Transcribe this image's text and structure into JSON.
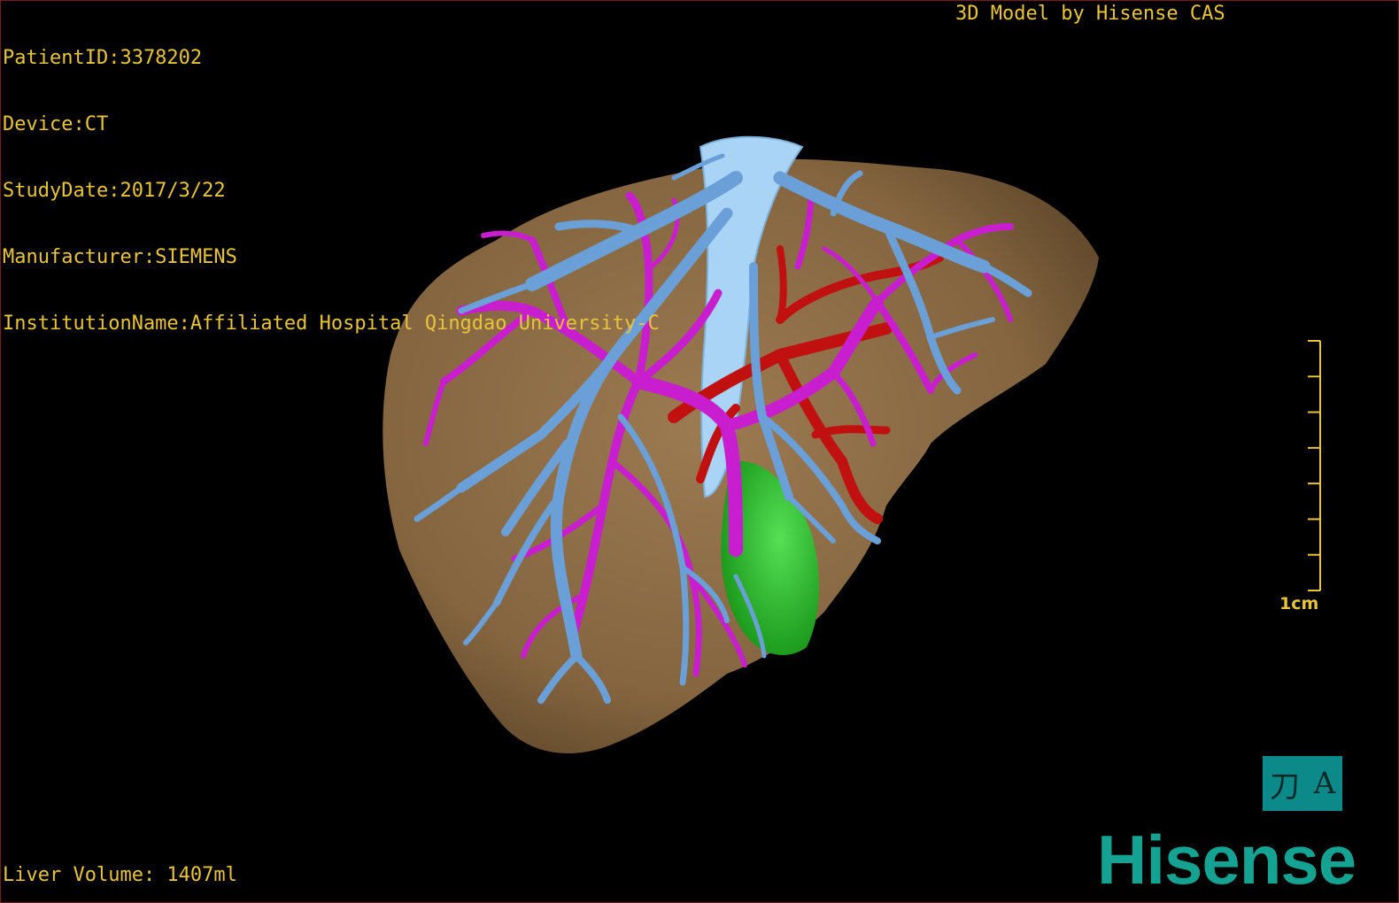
{
  "overlay": {
    "patient_id": "PatientID:3378202",
    "device": "Device:CT",
    "study_date": "StudyDate:2017/3/22",
    "manufacturer": "Manufacturer:SIEMENS",
    "institution": "InstitutionName:Affiliated Hospital Qingdao University-C",
    "model_credit": "3D Model by Hisense CAS",
    "liver_volume": "Liver Volume: 1407ml"
  },
  "scale": {
    "label": "1cm",
    "ticks": 8
  },
  "view_button": {
    "left_glyph": "刀",
    "right_glyph": "A"
  },
  "logo": "Hisense",
  "colors": {
    "text": "#e8c43a",
    "liver": "#8a6a45",
    "hepatic_vein": "#6a9fd8",
    "ivc": "#a9d4f5",
    "portal_vein": "#c81ecf",
    "artery": "#c01010",
    "gallbladder": "#22bb22",
    "logo": "#14a393",
    "button_bg": "#0c8a8a"
  }
}
